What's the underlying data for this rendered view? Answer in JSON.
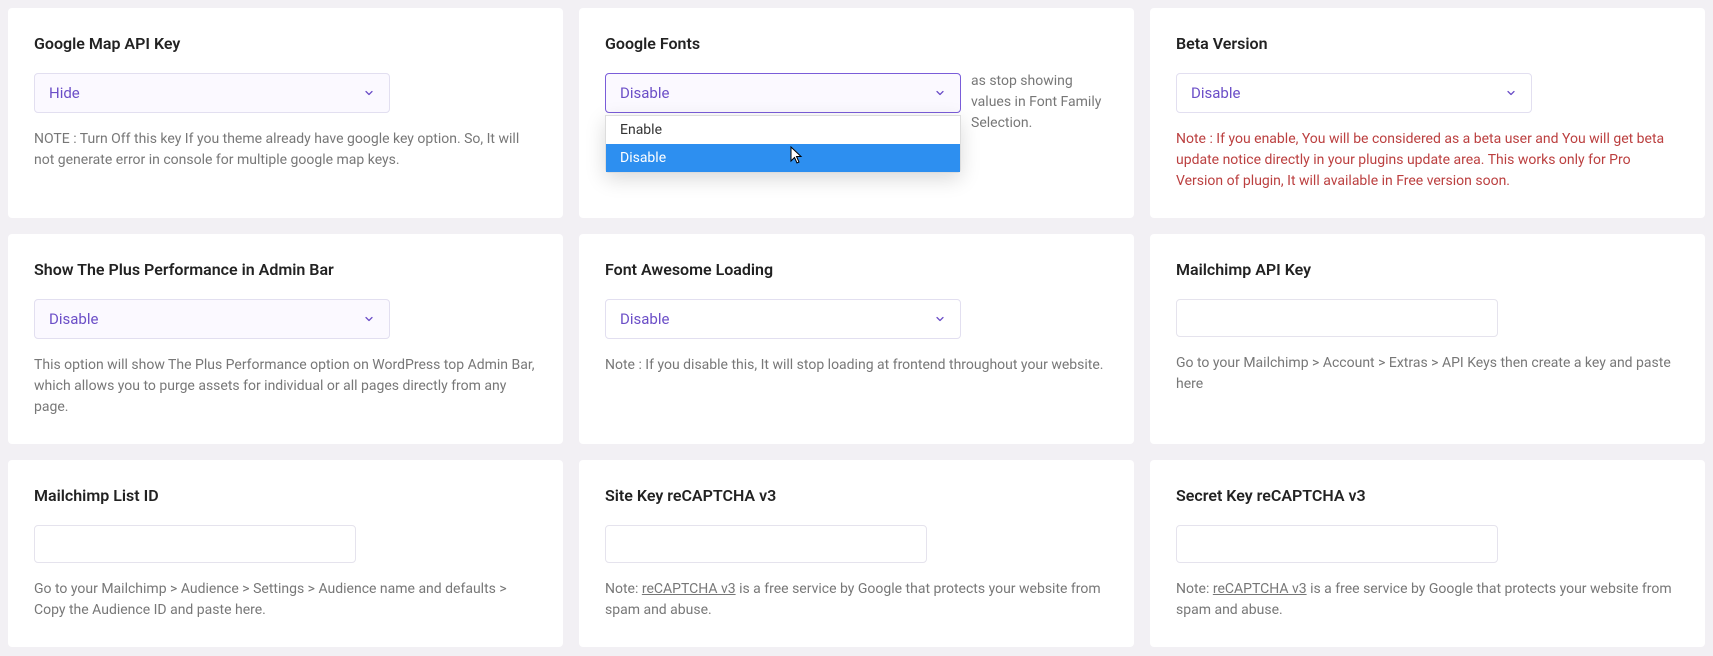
{
  "cards": {
    "googleMap": {
      "title": "Google Map API Key",
      "selected": "Hide",
      "note": "NOTE : Turn Off this key If you theme already have google key option. So, It will not generate error in console for multiple google map keys."
    },
    "googleFonts": {
      "title": "Google Fonts",
      "selected": "Disable",
      "options": [
        "Enable",
        "Disable"
      ],
      "note": "as stop showing values in Font Family Selection."
    },
    "beta": {
      "title": "Beta Version",
      "selected": "Disable",
      "note": "Note : If you enable, You will be considered as a beta user and You will get beta update notice directly in your plugins update area. This works only for Pro Version of plugin, It will available in Free version soon."
    },
    "adminBar": {
      "title": "Show The Plus Performance in Admin Bar",
      "selected": "Disable",
      "note": "This option will show The Plus Performance option on WordPress top Admin Bar, which allows you to purge assets for individual or all pages directly from any page."
    },
    "fontAwesome": {
      "title": "Font Awesome Loading",
      "selected": "Disable",
      "note": "Note : If you disable this, It will stop loading at frontend throughout your website."
    },
    "mailchimpKey": {
      "title": "Mailchimp API Key",
      "note": "Go to your Mailchimp > Account > Extras > API Keys then create a key and paste here"
    },
    "mailchimpList": {
      "title": "Mailchimp List ID",
      "note": "Go to your Mailchimp > Audience > Settings > Audience name and defaults > Copy the Audience ID and paste here."
    },
    "siteKey": {
      "title": "Site Key reCAPTCHA v3",
      "notePre": "Note: ",
      "link": "reCAPTCHA v3",
      "notePost": " is a free service by Google that protects your website from spam and abuse."
    },
    "secretKey": {
      "title": "Secret Key reCAPTCHA v3",
      "notePre": "Note: ",
      "link": "reCAPTCHA v3",
      "notePost": " is a free service by Google that protects your website from spam and abuse."
    }
  }
}
